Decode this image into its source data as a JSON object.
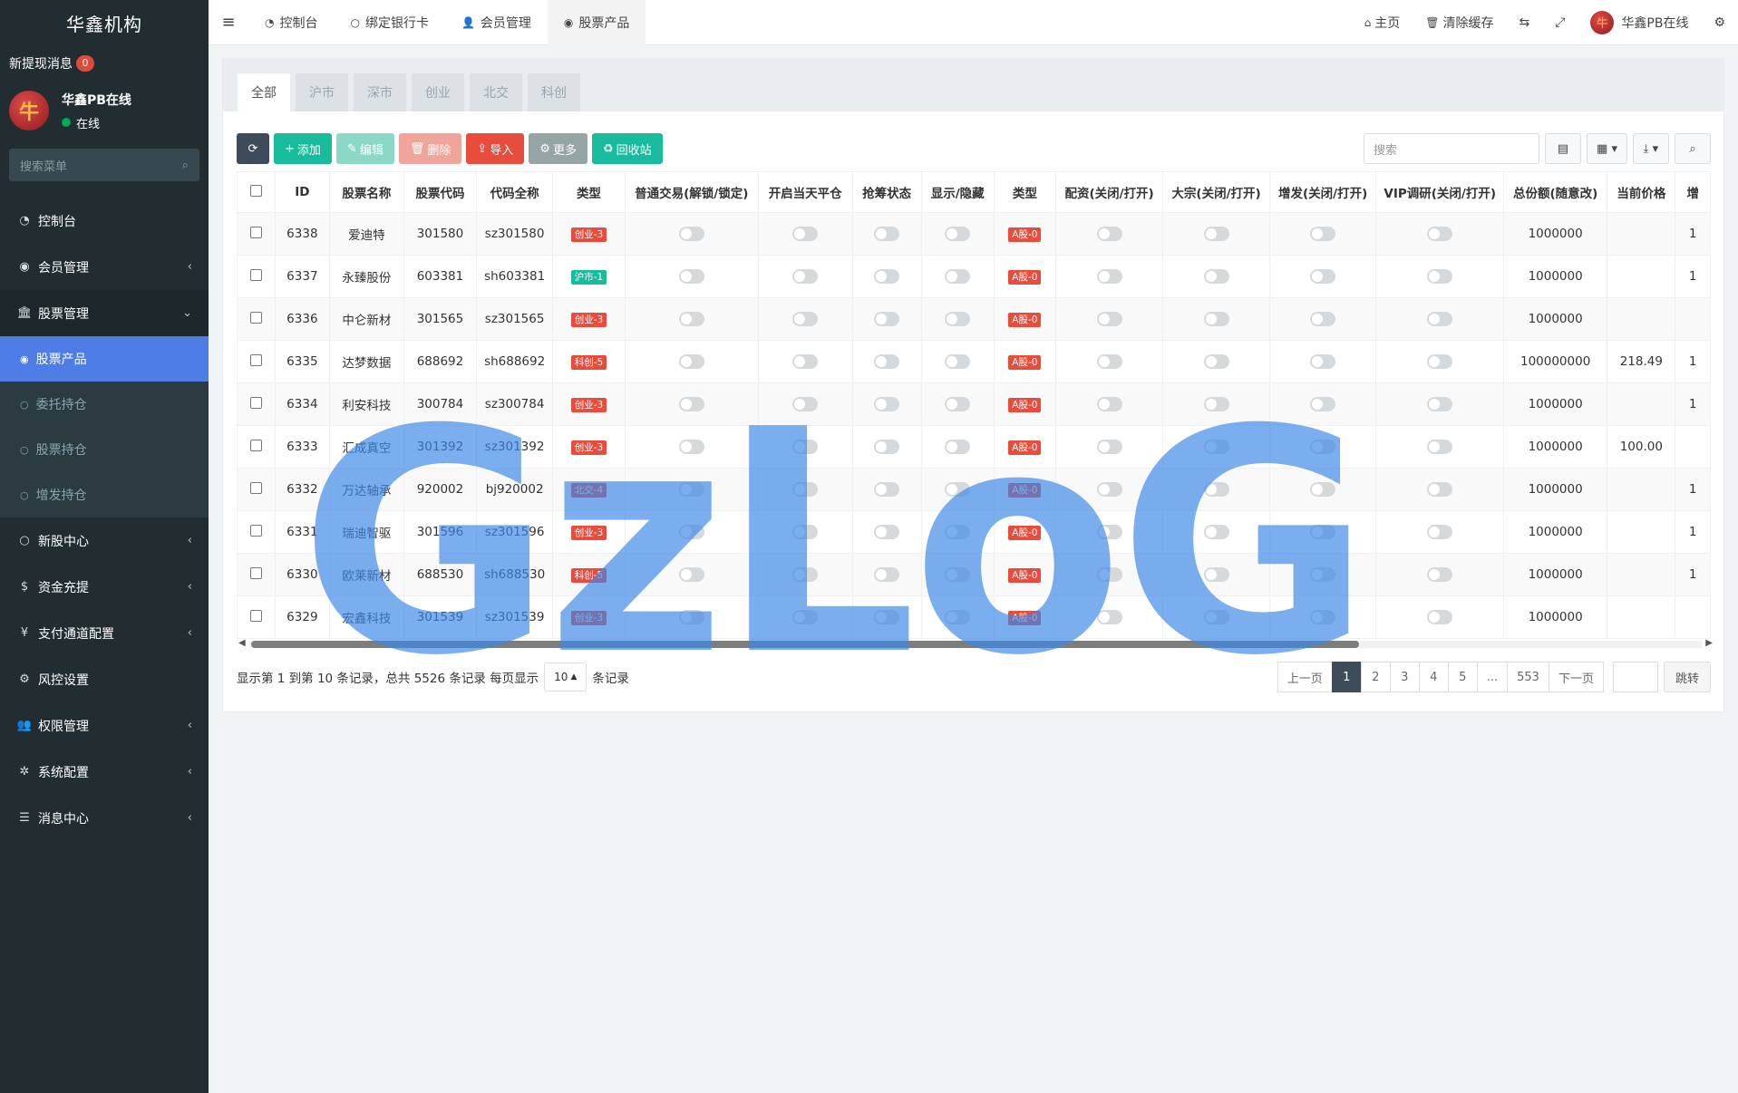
{
  "sidebar": {
    "brand": "华鑫机构",
    "notice_label": "新提现消息",
    "notice_count": "0",
    "avatar_glyph": "牛",
    "user_name": "华鑫PB在线",
    "user_status": "在线",
    "search_placeholder": "搜索菜单",
    "menu": [
      {
        "label": "控制台",
        "icon": "dashboard-icon"
      },
      {
        "label": "会员管理",
        "icon": "user-circle-icon"
      },
      {
        "label": "股票管理",
        "icon": "bank-icon"
      },
      {
        "label": "股票产品",
        "icon": "circle-dot-icon"
      },
      {
        "label": "委托持仓",
        "icon": "circle-icon"
      },
      {
        "label": "股票持仓",
        "icon": "circle-icon"
      },
      {
        "label": "增发持仓",
        "icon": "circle-icon"
      },
      {
        "label": "新股中心",
        "icon": "circle-icon"
      },
      {
        "label": "资金充提",
        "icon": "dollar-icon"
      },
      {
        "label": "支付通道配置",
        "icon": "yen-icon"
      },
      {
        "label": "风控设置",
        "icon": "gear-icon"
      },
      {
        "label": "权限管理",
        "icon": "users-icon"
      },
      {
        "label": "系统配置",
        "icon": "cog-icon"
      },
      {
        "label": "消息中心",
        "icon": "list-icon"
      }
    ]
  },
  "topnav": {
    "tabs": [
      "控制台",
      "绑定银行卡",
      "会员管理",
      "股票产品"
    ],
    "home": "主页",
    "clear_cache": "清除缓存",
    "user_name": "华鑫PB在线"
  },
  "subtabs": [
    "全部",
    "沪市",
    "深市",
    "创业",
    "北交",
    "科创"
  ],
  "toolbar": {
    "add": "添加",
    "edit": "编辑",
    "delete": "删除",
    "import": "导入",
    "more": "更多",
    "recycle": "回收站",
    "search_placeholder": "搜索"
  },
  "table": {
    "headers": [
      "ID",
      "股票名称",
      "股票代码",
      "代码全称",
      "类型",
      "普通交易(解锁/锁定)",
      "开启当天平仓",
      "抢筹状态",
      "显示/隐藏",
      "类型",
      "配资(关闭/打开)",
      "大宗(关闭/打开)",
      "增发(关闭/打开)",
      "VIP调研(关闭/打开)",
      "总份额(随意改)",
      "当前价格",
      "增"
    ],
    "rows": [
      {
        "id": "6338",
        "name": "爱迪特",
        "code": "301580",
        "full": "sz301580",
        "type": "创业-3",
        "type_color": "red",
        "type2": "A股-0",
        "total": "1000000",
        "price": "",
        "extra": "1"
      },
      {
        "id": "6337",
        "name": "永臻股份",
        "code": "603381",
        "full": "sh603381",
        "type": "沪市-1",
        "type_color": "green",
        "type2": "A股-0",
        "total": "1000000",
        "price": "",
        "extra": "1"
      },
      {
        "id": "6336",
        "name": "中仑新材",
        "code": "301565",
        "full": "sz301565",
        "type": "创业-3",
        "type_color": "red",
        "type2": "A股-0",
        "total": "1000000",
        "price": "",
        "extra": ""
      },
      {
        "id": "6335",
        "name": "达梦数据",
        "code": "688692",
        "full": "sh688692",
        "type": "科创-5",
        "type_color": "red",
        "type2": "A股-0",
        "total": "100000000",
        "price": "218.49",
        "extra": "1"
      },
      {
        "id": "6334",
        "name": "利安科技",
        "code": "300784",
        "full": "sz300784",
        "type": "创业-3",
        "type_color": "red",
        "type2": "A股-0",
        "total": "1000000",
        "price": "",
        "extra": "1"
      },
      {
        "id": "6333",
        "name": "汇成真空",
        "code": "301392",
        "full": "sz301392",
        "type": "创业-3",
        "type_color": "red",
        "type2": "A股-0",
        "total": "1000000",
        "price": "100.00",
        "extra": ""
      },
      {
        "id": "6332",
        "name": "万达轴承",
        "code": "920002",
        "full": "bj920002",
        "type": "北交-4",
        "type_color": "red",
        "type2": "A股-0",
        "total": "1000000",
        "price": "",
        "extra": "1"
      },
      {
        "id": "6331",
        "name": "瑞迪智驱",
        "code": "301596",
        "full": "sz301596",
        "type": "创业-3",
        "type_color": "red",
        "type2": "A股-0",
        "total": "1000000",
        "price": "",
        "extra": "1"
      },
      {
        "id": "6330",
        "name": "欧莱新材",
        "code": "688530",
        "full": "sh688530",
        "type": "科创-5",
        "type_color": "red",
        "type2": "A股-0",
        "total": "1000000",
        "price": "",
        "extra": "1"
      },
      {
        "id": "6329",
        "name": "宏鑫科技",
        "code": "301539",
        "full": "sz301539",
        "type": "创业-3",
        "type_color": "red",
        "type2": "A股-0",
        "total": "1000000",
        "price": "",
        "extra": ""
      }
    ]
  },
  "footer": {
    "summary": "显示第 1 到第 10 条记录，总共 5526 条记录 每页显示",
    "page_size": "10",
    "suffix": "条记录",
    "prev": "上一页",
    "pages": [
      "1",
      "2",
      "3",
      "4",
      "5",
      "...",
      "553"
    ],
    "next": "下一页",
    "go": "跳转"
  },
  "watermark": "GzLoG",
  "colors": {
    "sidebar_bg": "#222d32",
    "active_blue": "#4e7de5",
    "green": "#18bc9c",
    "red": "#e74c3c"
  }
}
